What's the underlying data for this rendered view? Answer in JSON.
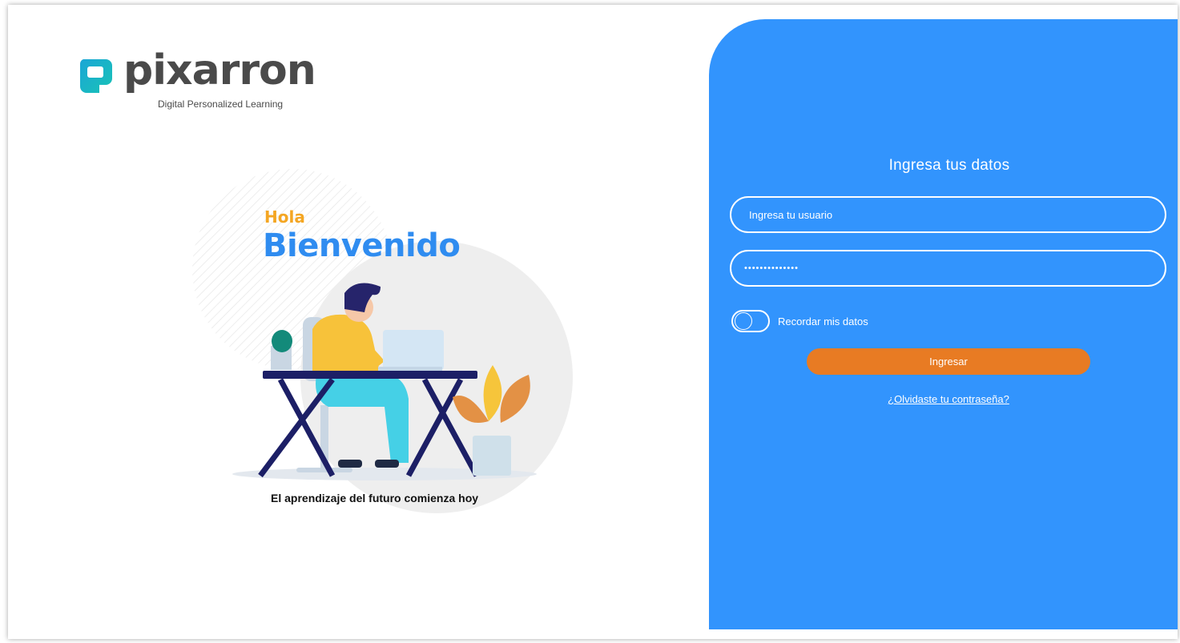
{
  "brand": {
    "name": "pixarron",
    "tagline": "Digital Personalized Learning",
    "logo_icon": "pixarron-logo-icon",
    "colors": {
      "logo_cyan": "#1aa6d6",
      "logo_teal": "#19c3b6",
      "text": "#4a4a4a"
    }
  },
  "hero": {
    "greeting": "Hola",
    "welcome": "Bienvenido",
    "caption": "El aprendizaje del futuro comienza hoy",
    "illustration": "person-at-desk-with-laptop-illustration",
    "colors": {
      "greeting": "#f4a623",
      "welcome": "#2f8cf0"
    }
  },
  "login": {
    "title": "Ingresa tus datos",
    "username_placeholder": "Ingresa tu usuario",
    "username_value": "",
    "password_value": "••••••••••••••",
    "remember_label": "Recordar mis datos",
    "remember_checked": false,
    "submit_label": "Ingresar",
    "forgot_label": "¿Olvidaste tu contraseña?",
    "colors": {
      "panel": "#3294fd",
      "button": "#e87b23"
    }
  }
}
